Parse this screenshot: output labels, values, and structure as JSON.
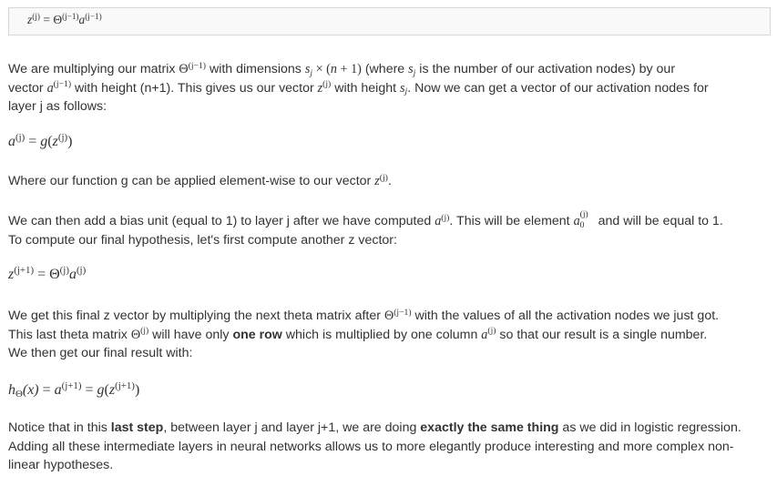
{
  "equation_box": {
    "lhs": "z",
    "lhs_sup": "(j)",
    "equals": "=",
    "theta": "Θ",
    "theta_sup": "(j−1)",
    "a": "a",
    "a_sup": "(j−1)"
  },
  "para1": {
    "t1": "We are multiplying our matrix ",
    "theta": "Θ",
    "theta_sup": "(j−1)",
    "t2": " with dimensions ",
    "s": "s",
    "s_sub": "j",
    "times": " × (",
    "n": "n",
    "plus1": " + 1)",
    "t3": " (where ",
    "s2": "s",
    "s2_sub": "j",
    "t4": " is the number of our activation nodes) by our",
    "t5": "vector ",
    "a": "a",
    "a_sup": "(j−1)",
    "t6": " with height (n+1). This gives us our vector ",
    "z": "z",
    "z_sup": "(j)",
    "t7": " with height ",
    "s3": "s",
    "s3_sub": "j",
    "t8": ". Now we can get a vector of our activation nodes for",
    "t9": "layer j as follows:"
  },
  "eq2": {
    "a": "a",
    "a_sup": "(j)",
    "rest1": " = ",
    "g": "g",
    "open": "(",
    "z": "z",
    "z_sup": "(j)",
    "close": ")"
  },
  "para2": {
    "t1": "Where our function g can be applied element-wise to our vector ",
    "z": "z",
    "z_sup": "(j)",
    "t2": "."
  },
  "para3": {
    "t1": "We can then add a bias unit (equal to 1) to layer j after we have computed ",
    "a": "a",
    "a_sup": "(j)",
    "t2": ". This will be element ",
    "a0": "a",
    "a0_sup": "(j)",
    "a0_sub": "0",
    "t3": " and will be equal to 1.",
    "t4": "To compute our final hypothesis, let's first compute another z vector:"
  },
  "eq3": {
    "z": "z",
    "z_sup": "(j+1)",
    "eq": " = ",
    "theta": "Θ",
    "theta_sup": "(j)",
    "a": "a",
    "a_sup": "(j)"
  },
  "para4": {
    "t1": "We get this final z vector by multiplying the next theta matrix after ",
    "theta": "Θ",
    "theta_sup": "(j−1)",
    "t2": " with the values of all the activation nodes we just got.",
    "t3": "This last theta matrix ",
    "theta2": "Θ",
    "theta2_sup": "(j)",
    "t4": " will have only ",
    "bold1": "one row",
    "t5": " which is multiplied by one column ",
    "a": "a",
    "a_sup": "(j)",
    "t6": " so that our result is a single number.",
    "t7": "We then get our final result with:"
  },
  "eq4": {
    "h": "h",
    "h_sub": "Θ",
    "x": "(x)",
    "eq1": " = ",
    "a": "a",
    "a_sup": "(j+1)",
    "eq2": " = ",
    "g": "g",
    "open": "(",
    "z": "z",
    "z_sup": "(j+1)",
    "close": ")"
  },
  "para5": {
    "t1": "Notice that in this ",
    "bold1": "last step",
    "t2": ", between layer j and layer j+1, we are doing ",
    "bold2": "exactly the same thing",
    "t3": " as we did in logistic regression.",
    "t4": "Adding all these intermediate layers in neural networks allows us to more elegantly produce interesting and more complex non-",
    "t5": "linear hypotheses."
  }
}
